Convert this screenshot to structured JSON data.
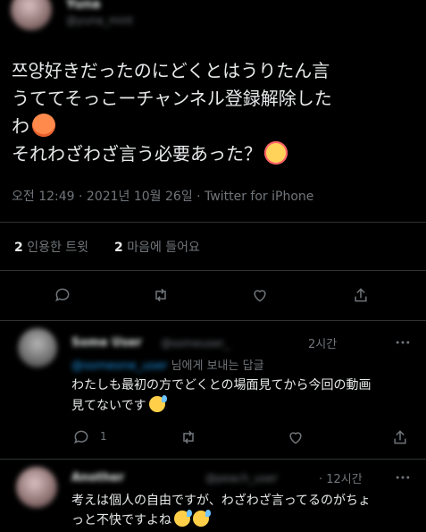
{
  "main_tweet": {
    "user_name": "Yuna",
    "handle": "@yuna_mint",
    "text_line1": "쯔양好きだったのにどくとはうりたん言",
    "text_line2": "うててそっこーチャンネル登録解除した",
    "text_line3": "わ",
    "text_line4": "それわざわざ言う必要あった？",
    "timestamp": "오전 12:49 · 2021년 10월 26일 · Twitter for iPhone",
    "retweet_count": "2",
    "retweet_label": "인용한 트윗",
    "like_count": "2",
    "like_label": "마음에 들어요"
  },
  "replies": [
    {
      "name": "Some User",
      "handle": "@someuser_",
      "time": "2시간",
      "reply_to_handle": "@someone_user",
      "reply_to_suffix": "님에게 보내는 답글",
      "text_line1": "わたしも最初の方でどくとの場面見てから今回の動画",
      "text_line2": "見てないです",
      "reply_count": "1"
    },
    {
      "name": "Another",
      "handle": "@peach_user",
      "time": "· 12시간",
      "text_line1": "考えは個人の自由ですが、わざわざ言ってるのがちょ",
      "text_line2": "っと不快ですよね"
    }
  ],
  "icons": [
    "reply-icon",
    "retweet-icon",
    "like-icon",
    "share-icon",
    "more-icon"
  ],
  "colors": {
    "background": "#000000",
    "text": "#e7e9ea",
    "muted": "#71767b",
    "divider": "#2f3336"
  }
}
